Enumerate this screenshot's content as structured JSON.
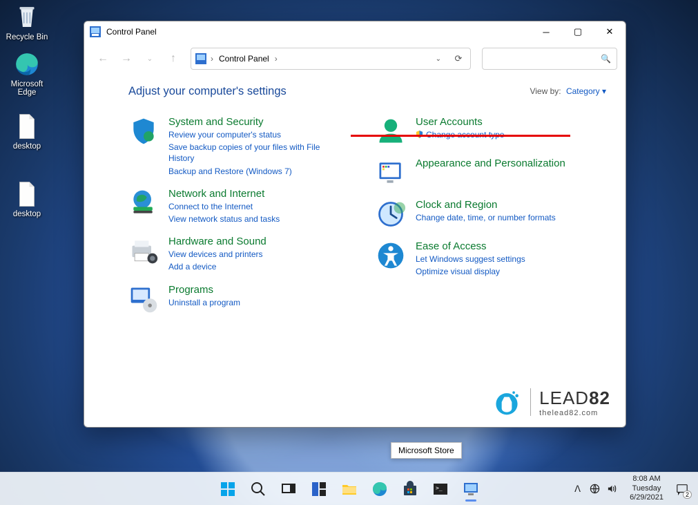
{
  "desktop": {
    "recycle": "Recycle Bin",
    "edge": "Microsoft Edge",
    "desk1": "desktop",
    "desk2": "desktop"
  },
  "window": {
    "title": "Control Panel",
    "breadcrumb": "Control Panel",
    "search_placeholder": ""
  },
  "content": {
    "header": "Adjust your computer's settings",
    "view_by_label": "View by:",
    "view_by_value": "Category"
  },
  "cats": {
    "sys": {
      "title": "System and Security",
      "l1": "Review your computer's status",
      "l2": "Save backup copies of your files with File History",
      "l3": "Backup and Restore (Windows 7)"
    },
    "net": {
      "title": "Network and Internet",
      "l1": "Connect to the Internet",
      "l2": "View network status and tasks"
    },
    "hw": {
      "title": "Hardware and Sound",
      "l1": "View devices and printers",
      "l2": "Add a device"
    },
    "prog": {
      "title": "Programs",
      "l1": "Uninstall a program"
    },
    "user": {
      "title": "User Accounts",
      "l1": "Change account type"
    },
    "appr": {
      "title": "Appearance and Personalization"
    },
    "clock": {
      "title": "Clock and Region",
      "l1": "Change date, time, or number formats"
    },
    "ease": {
      "title": "Ease of Access",
      "l1": "Let Windows suggest settings",
      "l2": "Optimize visual display"
    }
  },
  "watermark": {
    "brand_a": "LEAD",
    "brand_b": "82",
    "url": "thelead82.com"
  },
  "tooltip": "Microsoft Store",
  "clock": {
    "time": "8:08 AM",
    "day": "Tuesday",
    "date": "6/29/2021"
  },
  "notif_count": "2"
}
